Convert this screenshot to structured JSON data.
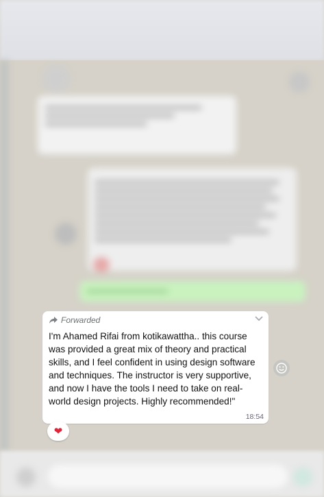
{
  "message": {
    "forwarded_label": "Forwarded",
    "text": "I'm Ahamed Rifai from kotikawattha.. this course was provided a great mix of theory and practical skills, and I feel confident in using design software and techniques. The instructor is very supportive, and now I have the tools I need to take on real-world design projects. Highly recommended!\"",
    "time": "18:54",
    "reaction": "❤"
  },
  "icons": {
    "forward": "forward-arrow-icon",
    "menu": "chevron-down-icon",
    "emoji": "emoji-icon"
  },
  "colors": {
    "reaction": "#e0243a",
    "bubble": "#ffffff",
    "outgoing": "#d9fdd3"
  }
}
